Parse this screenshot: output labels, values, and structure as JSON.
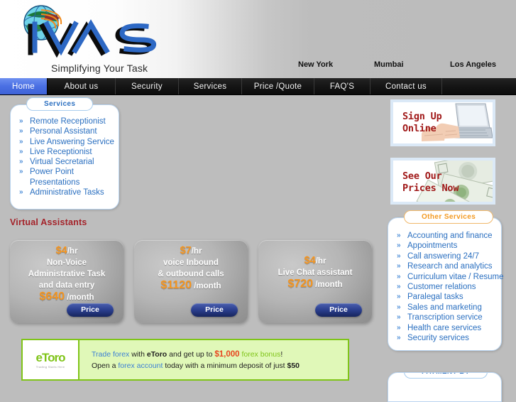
{
  "header": {
    "logo_text": "IVAS",
    "tagline": "Simplifying Your Task",
    "cities": [
      "New York",
      "Mumbai",
      "Los Angeles"
    ]
  },
  "nav": {
    "items": [
      {
        "label": "Home",
        "active": true
      },
      {
        "label": "About us",
        "active": false
      },
      {
        "label": "Security",
        "active": false
      },
      {
        "label": "Services",
        "active": false
      },
      {
        "label": "Price /Quote",
        "active": false
      },
      {
        "label": "FAQ'S",
        "active": false
      },
      {
        "label": "Contact us",
        "active": false
      }
    ]
  },
  "services_panel": {
    "title": "Services",
    "items": [
      "Remote Receptionist",
      "Personal Assistant",
      "Live Answering Service",
      "Live Receptionist",
      "Virtual Secretarial",
      "Power Point",
      "Presentations",
      "Administrative Tasks"
    ]
  },
  "promos": {
    "sign_up": "Sign Up\nOnline",
    "prices": "See Our\nPrices Now"
  },
  "other_services_panel": {
    "title": "Other Services",
    "items": [
      "Accounting and finance",
      "Appointments",
      "Call answering 24/7",
      "Research and analytics",
      "Curriculum vitae / Resume",
      "Customer relations",
      "Paralegal tasks",
      "Sales and marketing",
      "Transcription service",
      "Health care services",
      "Security services"
    ]
  },
  "payment_panel": {
    "title": "PAYMENT BY"
  },
  "main": {
    "section_heading": "Virtual Assistants",
    "cards": [
      {
        "rate": "$4",
        "rate_unit": "/hr",
        "desc_line_1": "Non-Voice",
        "desc_line_2": "Administrative Task",
        "desc_line_3": "and data entry",
        "monthly": "$640",
        "monthly_unit": "/month",
        "button": "Price"
      },
      {
        "rate": "$7",
        "rate_unit": "/hr",
        "desc_line_1": "voice Inbound",
        "desc_line_2": "& outbound calls",
        "desc_line_3": "",
        "monthly": "$1120",
        "monthly_unit": "/month",
        "button": "Price"
      },
      {
        "rate": "$4",
        "rate_unit": "/hr",
        "desc_line_1": "Live Chat assistant",
        "desc_line_2": "",
        "desc_line_3": "",
        "monthly": "$720",
        "monthly_unit": "/month",
        "button": "Price"
      }
    ]
  },
  "etoro_banner": {
    "logo_word": "eToro",
    "logo_sub": "Trading Starts Here",
    "line1_a": "Trade forex",
    "line1_b": " with ",
    "line1_c": "eToro",
    "line1_d": " and get up to ",
    "line1_e": "$1,000",
    "line1_f": " forex bonus",
    "line1_g": "!",
    "line2_a": "Open a ",
    "line2_b": "forex account",
    "line2_c": " today with a minimum deposit of just ",
    "line2_d": "$50"
  },
  "colors": {
    "nav_bg": "#111111",
    "nav_active": "#4a6fe3",
    "panel_blue": "#2a6fc0",
    "panel_orange": "#f39a21",
    "heading_red": "#a4232a",
    "price_orange": "#f5951f",
    "etoro_green": "#7fc418",
    "promo_red": "#a01818"
  }
}
